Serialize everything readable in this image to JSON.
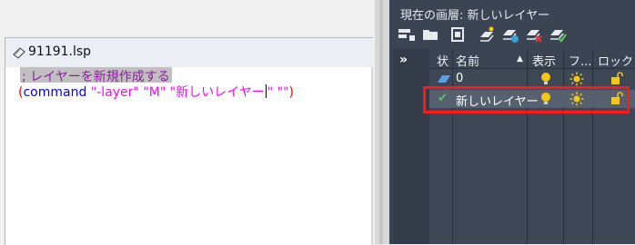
{
  "editor": {
    "filename": "91191.lsp",
    "line1": "; レイヤーを新規作成する",
    "line2": {
      "open_paren": "(",
      "keyword": "command",
      "args_before_caret": " \"-layer\" \"M\" \"新しいレイヤー",
      "args_after_caret": "\" \"\"",
      "close_paren": ")"
    }
  },
  "layer_panel": {
    "current_layer_label": "現在の画層: 新しいレイヤー",
    "toolbar_icons": [
      "new-layer-icon",
      "folder-icon",
      "layer-state-icon",
      "new-layer-vp-icon",
      "new-layer-frozen-icon",
      "delete-layer-icon",
      "set-current-icon"
    ],
    "expand_label": "»",
    "columns": [
      "状",
      "名前",
      "表示",
      "フ...",
      "ロック"
    ],
    "sort_indicator": "▲",
    "rows": [
      {
        "status": "",
        "name": "0",
        "visible": "on",
        "freeze": "thawed",
        "lock": "unlocked"
      },
      {
        "status": "✔",
        "name": "新しいレイヤー",
        "visible": "on",
        "freeze": "thawed",
        "lock": "unlocked"
      }
    ],
    "colors": {
      "panel_bg": "#3b4453",
      "selected_row": "#56606f",
      "highlight": "#ff1a1a",
      "bulb": "#f5c518",
      "sun": "#f5c518",
      "check": "#5fc35f"
    }
  }
}
